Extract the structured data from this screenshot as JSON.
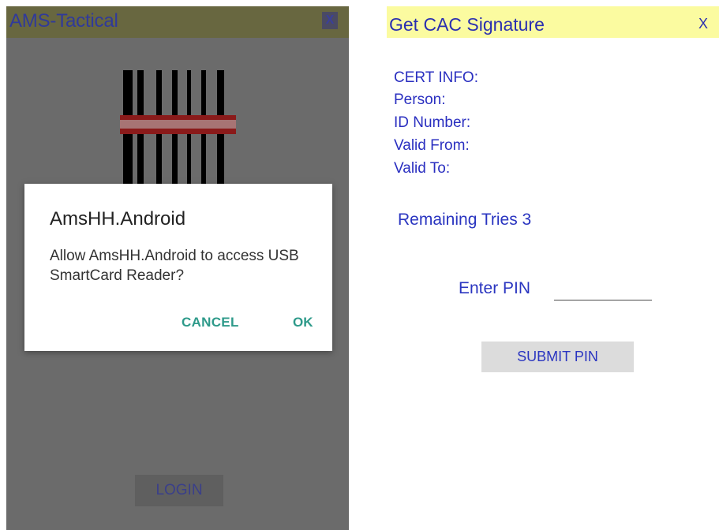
{
  "left": {
    "title": "AMS-Tactical",
    "close_label": "X",
    "dialog": {
      "title": "AmsHH.Android",
      "message": "Allow AmsHH.Android to access USB SmartCard Reader?",
      "cancel_label": "CANCEL",
      "ok_label": "OK"
    },
    "login_label": "LOGIN",
    "colors": {
      "titlebar_bg": "#686740",
      "screen_bg": "#6b6b6b",
      "dialog_accent": "#2e9a8a"
    }
  },
  "right": {
    "title": "Get CAC Signature",
    "close_label": "X",
    "cert_info": [
      "CERT INFO:",
      "Person:",
      "ID Number:",
      "Valid From:",
      "Valid To:"
    ],
    "remaining_tries": "Remaining Tries 3",
    "pin_label": "Enter PIN",
    "pin_value": "",
    "submit_label": "SUBMIT PIN",
    "colors": {
      "titlebar_bg": "#fbfba0",
      "text": "#2a35c0"
    }
  }
}
